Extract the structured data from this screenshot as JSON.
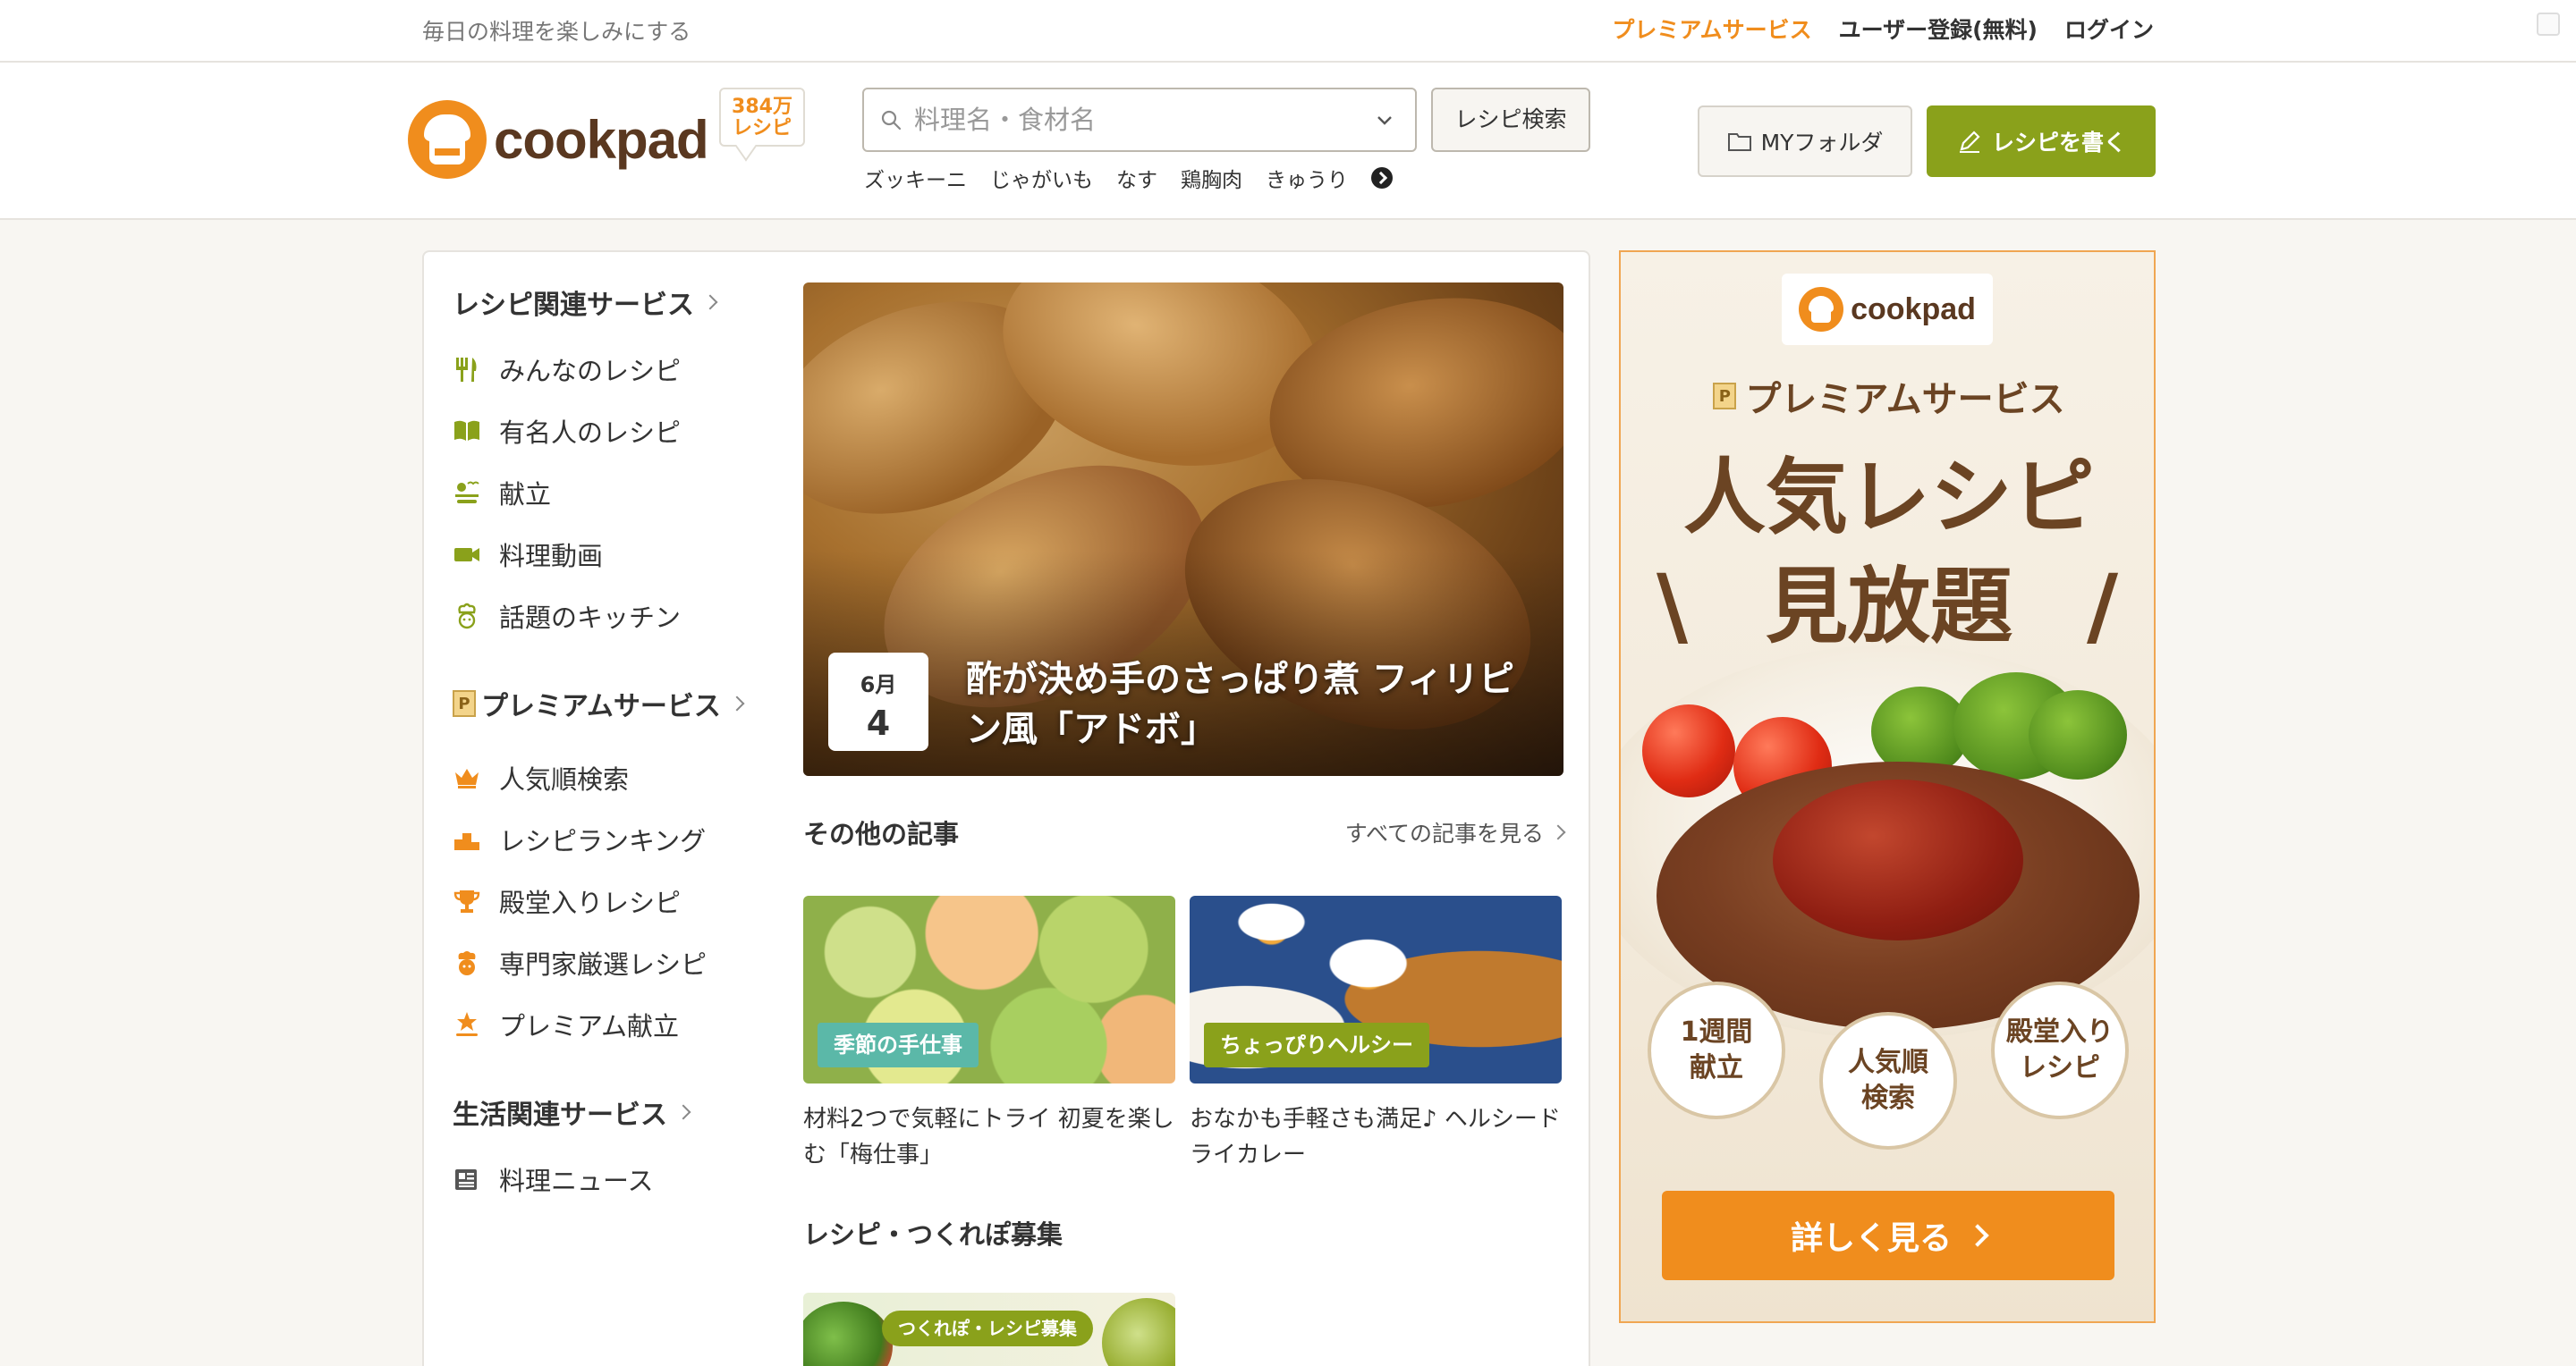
{
  "topbar": {
    "tagline": "毎日の料理を楽しみにする",
    "links": {
      "premium": "プレミアムサービス",
      "register": "ユーザー登録(無料)",
      "login": "ログイン"
    }
  },
  "header": {
    "logo_text": "cookpad",
    "recipe_count_line1": "384万",
    "recipe_count_line2": "レシピ",
    "search": {
      "placeholder": "料理名・食材名",
      "value": ""
    },
    "search_button": "レシピ検索",
    "keywords": [
      "ズッキーニ",
      "じゃがいも",
      "なす",
      "鶏胸肉",
      "きゅうり"
    ],
    "my_folder": "MYフォルダ",
    "write_recipe": "レシピを書く"
  },
  "sidebar": {
    "recipe_services": {
      "title": "レシピ関連サービス",
      "items": [
        {
          "label": "みんなのレシピ",
          "icon": "fork-knife-icon"
        },
        {
          "label": "有名人のレシピ",
          "icon": "book-icon"
        },
        {
          "label": "献立",
          "icon": "meal-set-icon"
        },
        {
          "label": "料理動画",
          "icon": "video-camera-icon"
        },
        {
          "label": "話題のキッチン",
          "icon": "chef-icon"
        }
      ]
    },
    "premium_services": {
      "title": "プレミアムサービス",
      "badge": "P",
      "items": [
        {
          "label": "人気順検索",
          "icon": "crown-icon"
        },
        {
          "label": "レシピランキング",
          "icon": "ranking-icon"
        },
        {
          "label": "殿堂入りレシピ",
          "icon": "trophy-icon"
        },
        {
          "label": "専門家厳選レシピ",
          "icon": "expert-icon"
        },
        {
          "label": "プレミアム献立",
          "icon": "star-meal-icon"
        }
      ]
    },
    "life_services": {
      "title": "生活関連サービス",
      "items": [
        {
          "label": "料理ニュース",
          "icon": "newspaper-icon"
        }
      ]
    }
  },
  "hero": {
    "month": "6月",
    "day": "4",
    "title": "酢が決め手のさっぱり煮 フィリピン風「アドボ」"
  },
  "other_articles": {
    "title": "その他の記事",
    "see_all": "すべての記事を見る",
    "items": [
      {
        "tag": "季節の手仕事",
        "text": "材料2つで気軽にトライ 初夏を楽しむ「梅仕事」",
        "tag_color": "#5bb8a8"
      },
      {
        "tag": "ちょっぴりヘルシー",
        "text": "おなかも手軽さも満足♪ ヘルシードライカレー",
        "tag_color": "#8aa11b"
      }
    ]
  },
  "recruit": {
    "title": "レシピ・つくれぽ募集",
    "banner_label": "つくれぽ・レシピ募集"
  },
  "ad": {
    "logo_text": "cookpad",
    "premium_badge": "P",
    "premium_label": "プレミアムサービス",
    "headline_line1": "人気レシピ",
    "headline_line2": "見放題",
    "slash_left": "\\",
    "slash_right": "/",
    "circles": [
      {
        "line1": "1週間",
        "line2": "献立"
      },
      {
        "line1": "人気順",
        "line2": "検索"
      },
      {
        "line1": "殿堂入り",
        "line2": "レシピ"
      }
    ],
    "cta": "詳しく見る"
  },
  "colors": {
    "brand_orange": "#f08d1d",
    "write_green": "#8aa11b",
    "brown": "#6b4423"
  }
}
